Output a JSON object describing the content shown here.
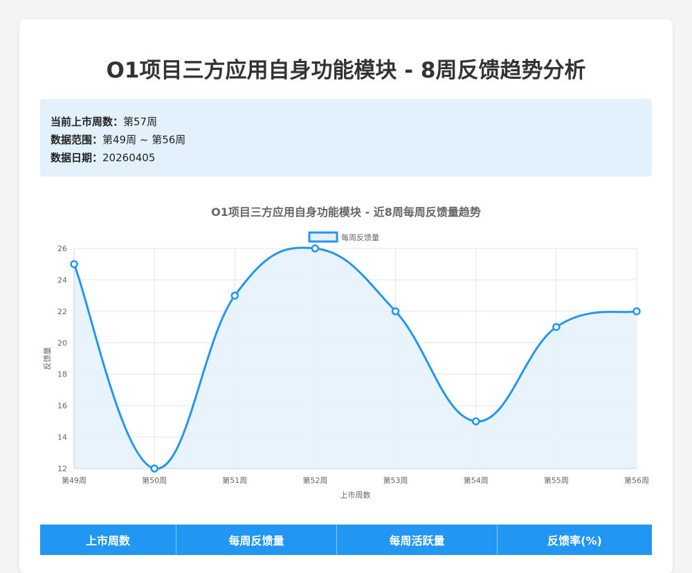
{
  "header": {
    "title": "O1项目三方应用自身功能模块 - 8周反馈趋势分析"
  },
  "info": {
    "rows": [
      {
        "label": "当前上市周数：",
        "value": "第57周"
      },
      {
        "label": "数据范围：",
        "value": "第49周 ~ 第56周"
      },
      {
        "label": "数据日期：",
        "value": "20260405"
      }
    ]
  },
  "chart_data": {
    "type": "line",
    "title": "O1项目三方应用自身功能模块 - 近8周每周反馈量趋势",
    "xlabel": "上市周数",
    "ylabel": "反馈量",
    "categories": [
      "第49周",
      "第50周",
      "第51周",
      "第52周",
      "第53周",
      "第54周",
      "第55周",
      "第56周"
    ],
    "series": [
      {
        "name": "每周反馈量",
        "values": [
          25,
          12,
          23,
          26,
          22,
          15,
          21,
          22
        ]
      }
    ],
    "ylim": [
      12,
      26
    ],
    "yticks": [
      12,
      14,
      16,
      18,
      20,
      22,
      24,
      26
    ],
    "grid": true,
    "legend": "top-center",
    "line_color": "#2196f3",
    "fill_color": "#e5f2fc",
    "smooth": true
  },
  "table": {
    "headers": [
      "上市周数",
      "每周反馈量",
      "每周活跃量",
      "反馈率(%)"
    ],
    "header_color": "#2196f3"
  }
}
